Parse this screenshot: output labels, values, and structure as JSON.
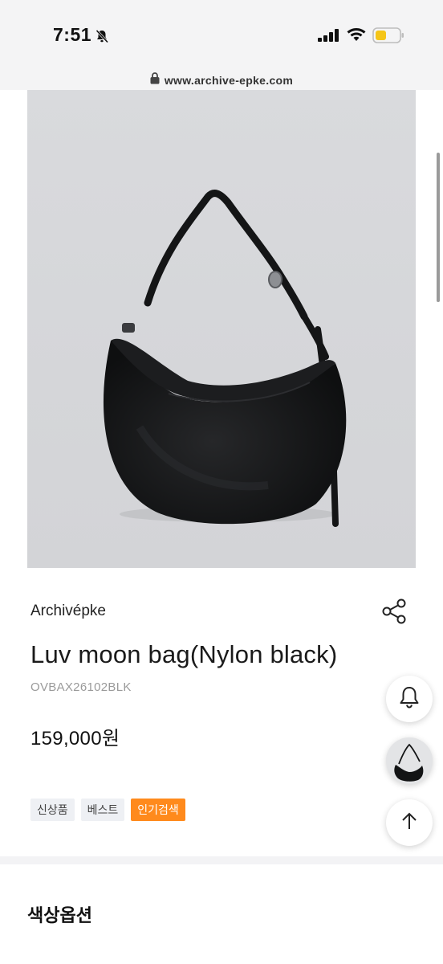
{
  "status_bar": {
    "time": "7:51",
    "icons": [
      "bell-slash-icon",
      "signal-icon",
      "wifi-icon",
      "battery-low-icon"
    ],
    "battery_color": "#f5c518"
  },
  "browser": {
    "url": "www.archive-epke.com"
  },
  "product": {
    "brand": "Archivépke",
    "name": "Luv moon bag(Nylon black)",
    "code": "OVBAX26102BLK",
    "price": "159,000원",
    "tags": [
      {
        "label": "신상품"
      },
      {
        "label": "베스트"
      },
      {
        "label": "인기검색"
      }
    ],
    "hot_tag_color": "#ff8a1c"
  },
  "options": {
    "title": "색상옵션"
  },
  "floating_buttons": [
    "bell-icon",
    "recent-product-thumbnail",
    "arrow-up-icon"
  ]
}
